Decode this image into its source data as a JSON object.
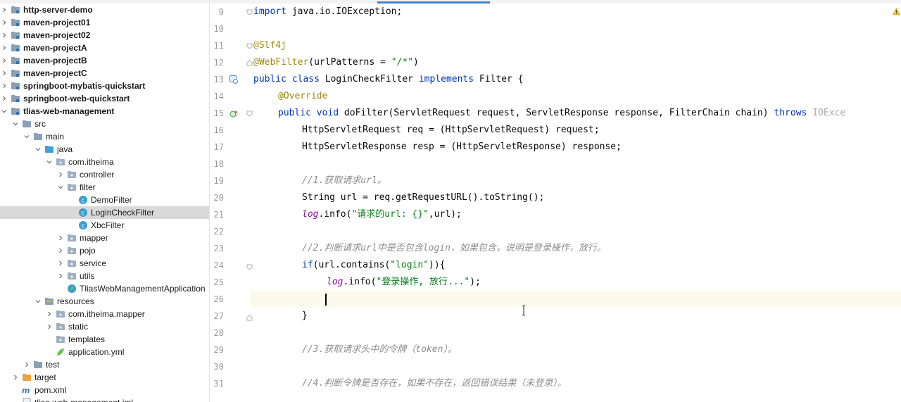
{
  "tree": {
    "items": [
      {
        "label": "http-server-demo",
        "bold": true
      },
      {
        "label": "maven-project01",
        "bold": true
      },
      {
        "label": "maven-project02",
        "bold": true
      },
      {
        "label": "maven-projectA",
        "bold": true
      },
      {
        "label": "maven-projectB",
        "bold": true
      },
      {
        "label": "maven-projectC",
        "bold": true
      },
      {
        "label": "springboot-mybatis-quickstart",
        "bold": true
      },
      {
        "label": "springboot-web-quickstart",
        "bold": true
      },
      {
        "label": "tlias-web-management",
        "bold": true
      },
      {
        "label": "src"
      },
      {
        "label": "main"
      },
      {
        "label": "java"
      },
      {
        "label": "com.itheima"
      },
      {
        "label": "controller"
      },
      {
        "label": "filter"
      },
      {
        "label": "DemoFilter"
      },
      {
        "label": "LoginCheckFilter"
      },
      {
        "label": "XbcFilter"
      },
      {
        "label": "mapper"
      },
      {
        "label": "pojo"
      },
      {
        "label": "service"
      },
      {
        "label": "utils"
      },
      {
        "label": "TliasWebManagementApplication"
      },
      {
        "label": "resources"
      },
      {
        "label": "com.itheima.mapper"
      },
      {
        "label": "static"
      },
      {
        "label": "templates"
      },
      {
        "label": "application.yml"
      },
      {
        "label": "test"
      },
      {
        "label": "target"
      },
      {
        "label": "pom.xml"
      },
      {
        "label": "tlias-web-management.iml"
      }
    ]
  },
  "editor": {
    "line_numbers": [
      "9",
      "10",
      "11",
      "12",
      "13",
      "14",
      "15",
      "16",
      "17",
      "18",
      "19",
      "20",
      "21",
      "22",
      "23",
      "24",
      "25",
      "26",
      "27",
      "28",
      "29",
      "30",
      "31"
    ],
    "lines": {
      "l9": {
        "kw": "import",
        "rest": " java.io.IOException;"
      },
      "l11": {
        "an": "@Slf4j"
      },
      "l12": {
        "an": "@WebFilter",
        "a": "(urlPatterns = ",
        "s": "\"/*\"",
        "b": ")"
      },
      "l13": {
        "kw1": "public class",
        "a": " LoginCheckFilter ",
        "kw2": "implements",
        "b": " Filter {"
      },
      "l14": {
        "an": "@Override"
      },
      "l15": {
        "kw1": "public void",
        "a": " doFilter(ServletRequest request, ServletResponse response, FilterChain chain) ",
        "kw2": "throws",
        "dim": " IOExce"
      },
      "l16": {
        "a": "HttpServletRequest req = (HttpServletRequest) request;"
      },
      "l17": {
        "a": "HttpServletResponse resp = (HttpServletResponse) response;"
      },
      "l19": {
        "cm": "//1.获取请求url。"
      },
      "l20": {
        "a": "String url = req.getRequestURL().toString();"
      },
      "l21": {
        "lg": "log",
        "a": ".info(",
        "s": "\"请求的url: {}\"",
        "b": ",url);"
      },
      "l23": {
        "cm": "//2.判断请求url中是否包含login，如果包含，说明是登录操作，放行。"
      },
      "l24": {
        "kw": "if",
        "a": "(url.contains(",
        "s": "\"login\"",
        "b": ")){"
      },
      "l25": {
        "lg": "log",
        "a": ".info(",
        "s": "\"登录操作, 放行...\"",
        "b": ");"
      },
      "l27": {
        "a": "}"
      },
      "l29": {
        "cm": "//3.获取请求头中的令牌（token）。"
      },
      "l31": {
        "cm": "//4.判断令牌是否存在，如果不存在，返回错误结果（未登录）。"
      }
    }
  },
  "colors": {
    "keyword": "#0033b3",
    "annotation": "#9e880d",
    "string": "#067d17",
    "comment": "#8c8c8c",
    "log_field": "#871094",
    "selected_row": "#d9d9d9",
    "current_line": "#fcfaed",
    "folder": "#8aa0b6",
    "source_folder": "#40a0e0",
    "target_folder": "#e8a33d",
    "class_icon": "#3aa0d0"
  }
}
